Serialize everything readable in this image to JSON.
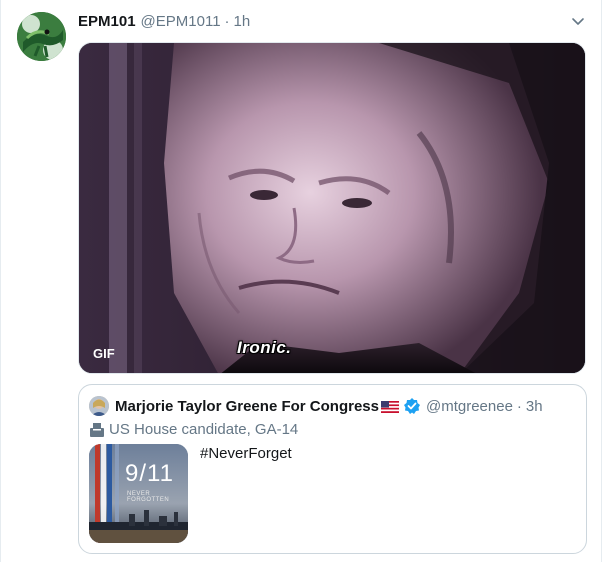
{
  "tweet": {
    "author_name": "EPM101",
    "author_handle": "@EPM1011",
    "separator": "·",
    "time": "1h",
    "avatar_icon": "lizard-avatar",
    "more_icon": "chevron-down-icon",
    "media": {
      "badge": "GIF",
      "caption": "Ironic."
    }
  },
  "quoted_tweet": {
    "author_name": "Marjorie Taylor Greene For Congress",
    "flag_icon": "us-flag-icon",
    "verified_icon": "verified-badge-icon",
    "author_handle": "@mtgreenee",
    "separator": "·",
    "time": "3h",
    "label_icon": "ballot-box-icon",
    "label": "US House candidate, GA-14",
    "thumbnail": {
      "title": "9/11",
      "subtitle": "NEVER FORGOTTEN"
    },
    "text": "#NeverForget"
  },
  "colors": {
    "text_primary": "#14171a",
    "text_secondary": "#657786",
    "verified_blue": "#1da1f2",
    "border": "#ccd6dd"
  }
}
